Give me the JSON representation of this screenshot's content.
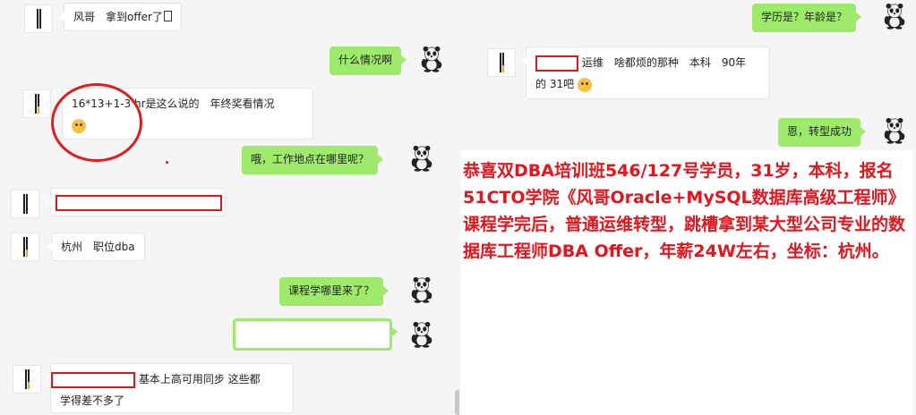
{
  "left_messages": {
    "m1": {
      "text_before": "风哥　拿到offer了",
      "tofu": ""
    },
    "m2": {
      "text": "什么情况啊"
    },
    "m3": {
      "formula": "16*13+1-3",
      "text": " hr是这么说的　年终奖看情况"
    },
    "m4": {
      "text": "哦，工作地点在哪里呢？"
    },
    "m5": {
      "text": ""
    },
    "m6": {
      "text": "杭州　职位dba"
    },
    "m7": {
      "text": "课程学哪里来了？"
    },
    "m8": {
      "text": ""
    },
    "m9": {
      "line1": " 基本上高可用同步 这些都",
      "line2": "学得差不多了"
    }
  },
  "right_messages": {
    "r1": {
      "text": "学历是？年龄是？"
    },
    "r2": {
      "line1": " 运维　啥都烦的那种　本科　90年",
      "line2": "的 31吧"
    },
    "r3": {
      "text": "恩，转型成功"
    }
  },
  "announcement": {
    "text": "恭喜双DBA培训班546/127号学员，31岁，本科，报名51CTO学院《风哥Oracle+MySQL数据库高级工程师》课程学完后，普通运维转型，跳槽拿到某大型公司专业的数据库工程师DBA Offer，年薪24W左右，坐标：杭州。"
  },
  "colors": {
    "self_bubble": "#9eea6a",
    "contact_bubble": "#ffffff",
    "annotation_red": "#e21b1b",
    "announcement_text": "#e8141c"
  },
  "icons": {
    "self_avatar": "panda-avatar-icon",
    "contact_avatar": "contact-avatar-icon",
    "emoji": "laughing-emoji-icon"
  }
}
